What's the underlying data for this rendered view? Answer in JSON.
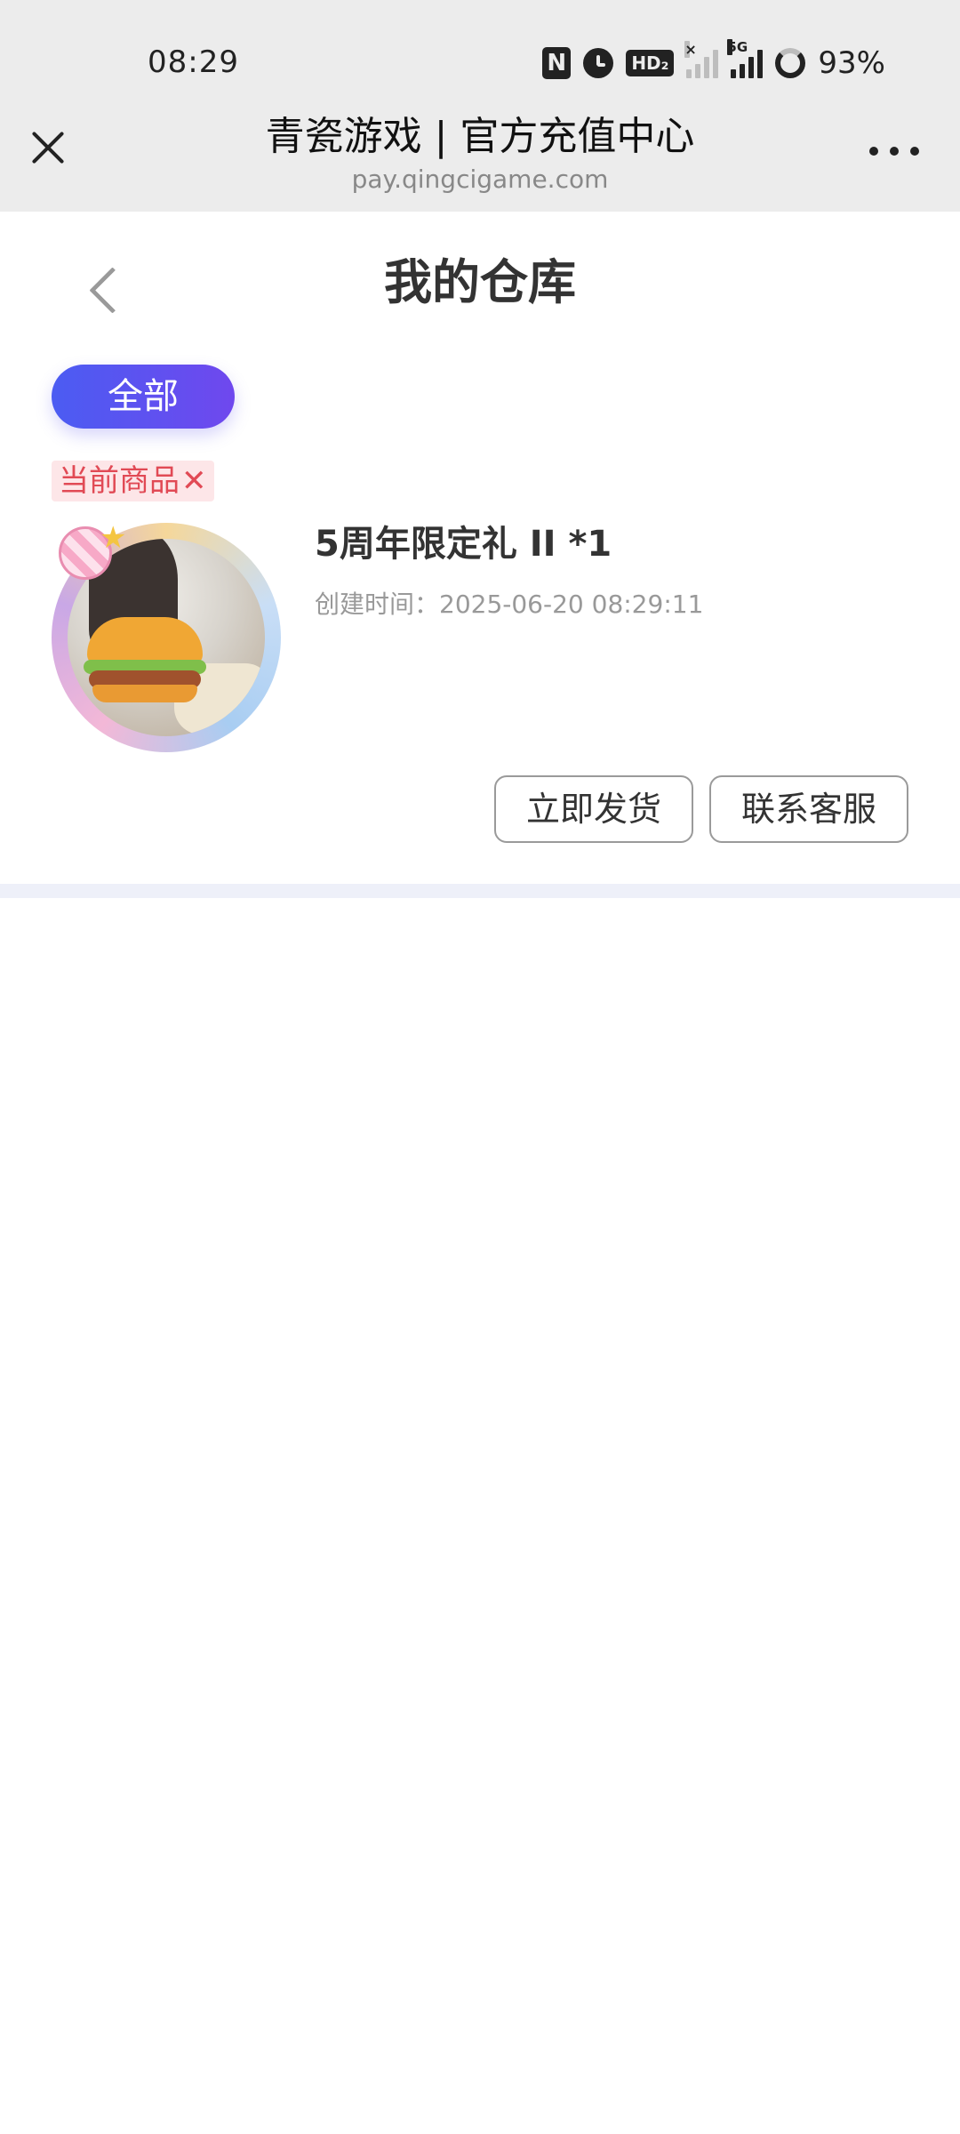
{
  "status_bar": {
    "time": "08:29",
    "nfc_label": "N",
    "hd_label": "HD₂",
    "network_label": "5G",
    "battery": "93%"
  },
  "browser": {
    "title": "青瓷游戏 | 官方充值中心",
    "url": "pay.qingcigame.com"
  },
  "page": {
    "title": "我的仓库"
  },
  "filter": {
    "active_label": "全部"
  },
  "item": {
    "tag_label": "当前商品",
    "tag_close": "✕",
    "name": "5周年限定礼 II *1",
    "created": "创建时间：2025-06-20 08:29:11",
    "ship_button": "立即发货",
    "service_button": "联系客服"
  },
  "colors": {
    "accent_start": "#4b5cf2",
    "accent_end": "#6f48ee",
    "tag_text": "#e14a55",
    "tag_bg": "#fde6e8"
  }
}
